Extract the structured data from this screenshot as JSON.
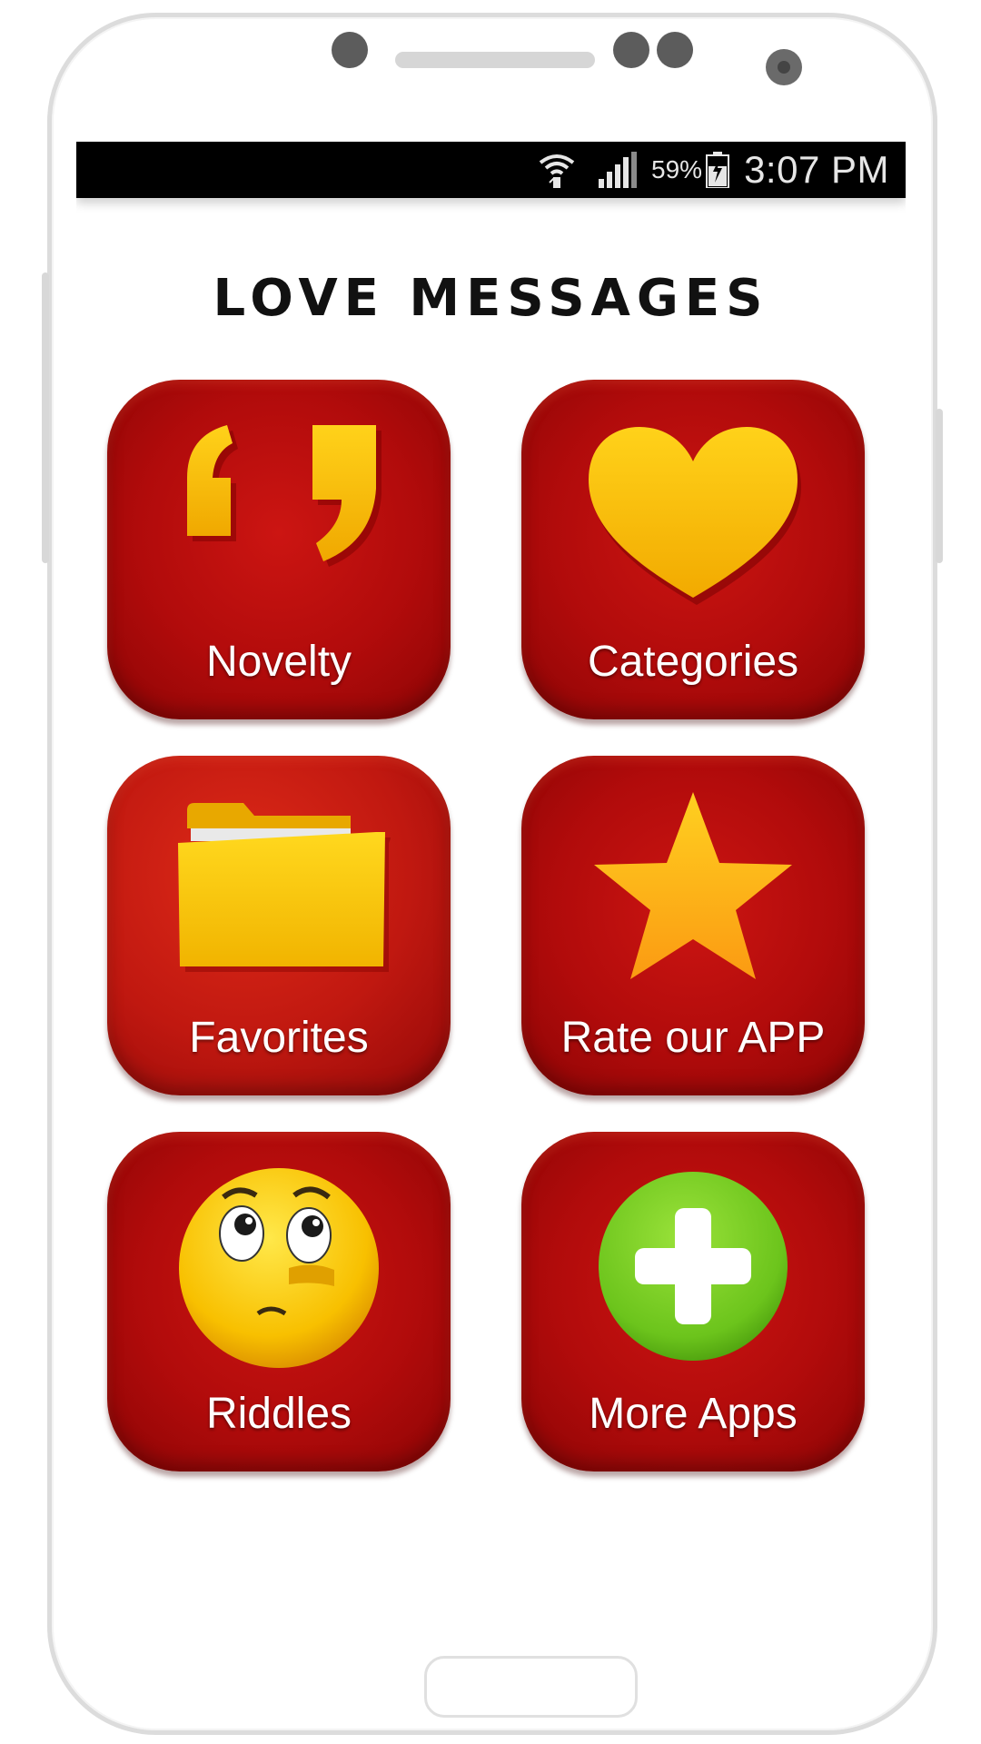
{
  "status_bar": {
    "battery": "59%",
    "time": "3:07 PM",
    "icons": [
      "wifi-icon",
      "signal-icon",
      "battery-charging-icon"
    ]
  },
  "app": {
    "title": "LOVE MESSAGES"
  },
  "tiles": [
    {
      "label": "Novelty",
      "icon": "quotes-icon"
    },
    {
      "label": "Categories",
      "icon": "heart-icon"
    },
    {
      "label": "Favorites",
      "icon": "folder-icon"
    },
    {
      "label": "Rate our APP",
      "icon": "star-icon"
    },
    {
      "label": "Riddles",
      "icon": "thinking-face-icon"
    },
    {
      "label": "More Apps",
      "icon": "plus-circle-icon"
    }
  ],
  "colors": {
    "tile_red": "#b10b0b",
    "icon_yellow": "#f5c400",
    "plus_green": "#6cc41c",
    "status_bar": "#000000"
  }
}
